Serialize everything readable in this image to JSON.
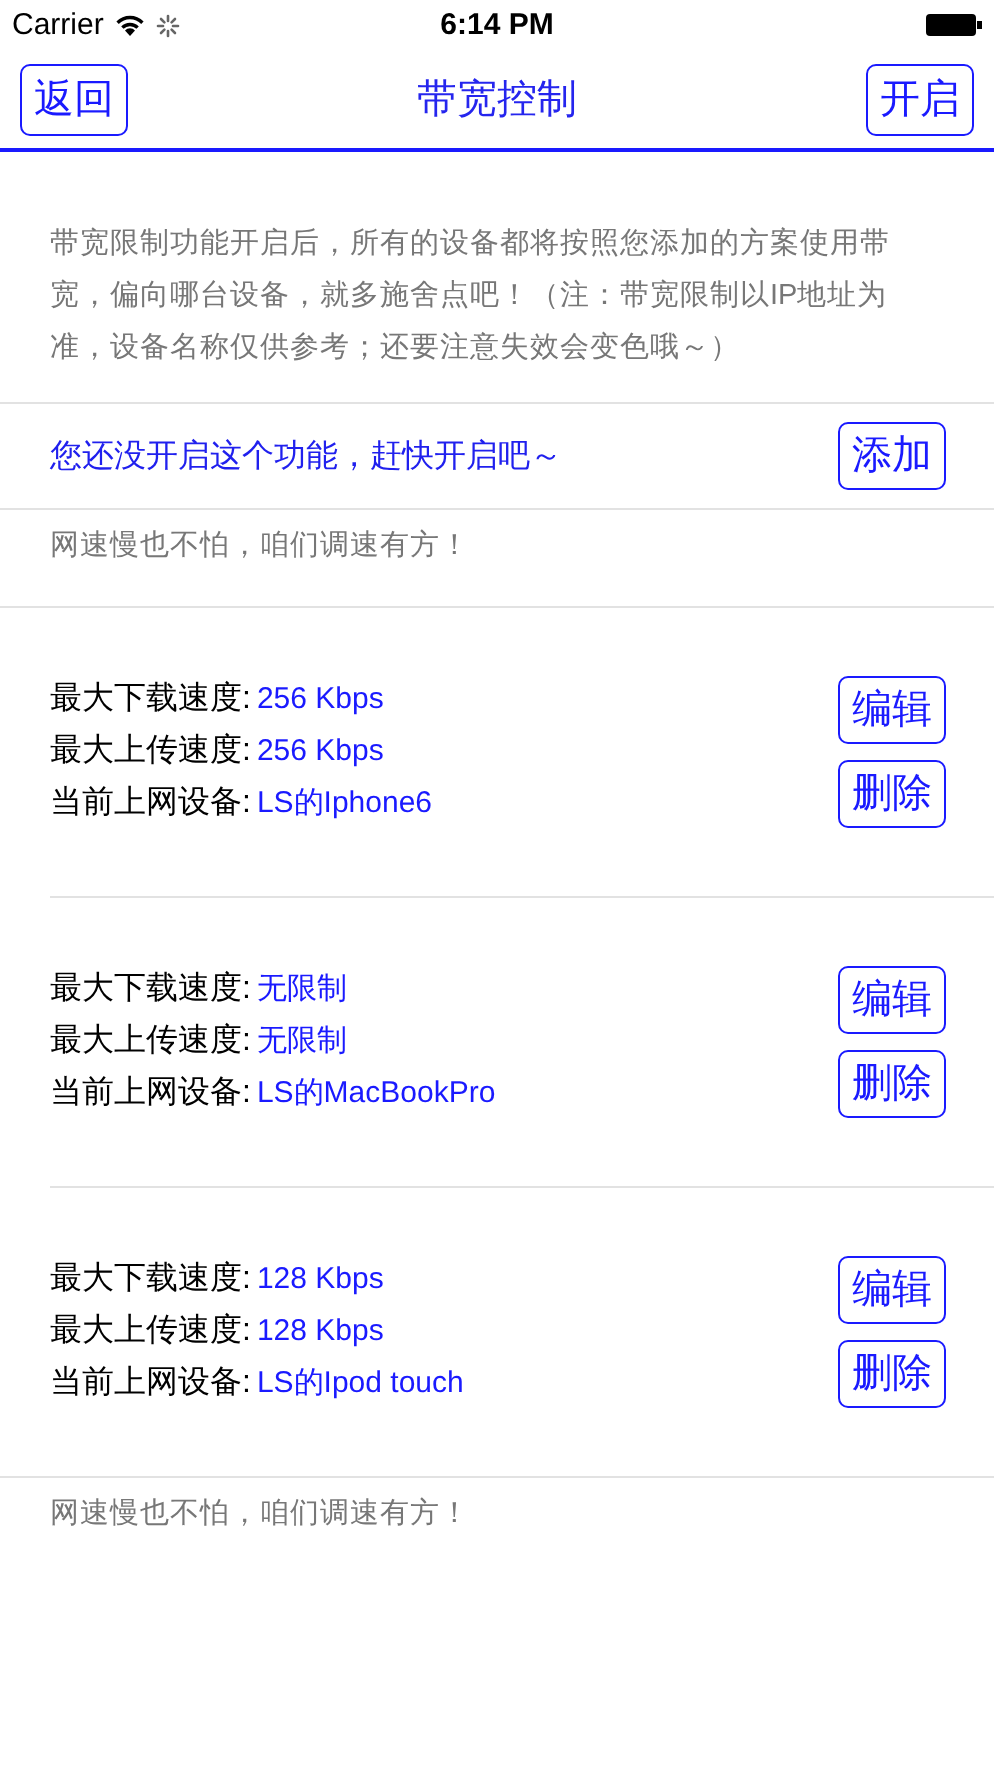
{
  "status_bar": {
    "carrier": "Carrier",
    "time": "6:14 PM"
  },
  "nav": {
    "back": "返回",
    "title": "带宽控制",
    "action": "开启"
  },
  "intro": "带宽限制功能开启后，所有的设备都将按照您添加的方案使用带宽，偏向哪台设备，就多施舍点吧！（注：带宽限制以IP地址为准，设备名称仅供参考；还要注意失效会变色哦～）",
  "notice": {
    "text": "您还没开启这个功能，赶快开启吧～",
    "button": "添加"
  },
  "slogan": "网速慢也不怕，咱们调速有方！",
  "rules": [
    {
      "download_label": "最大下载速度:",
      "download": "256 Kbps",
      "upload_label": "最大上传速度:",
      "upload": "256 Kbps",
      "device_label": "当前上网设备:",
      "device": "LS的Iphone6",
      "edit": "编辑",
      "delete": "删除"
    },
    {
      "download_label": "最大下载速度:",
      "download": "无限制",
      "upload_label": "最大上传速度:",
      "upload": "无限制",
      "device_label": "当前上网设备:",
      "device": "LS的MacBookPro",
      "edit": "编辑",
      "delete": "删除"
    },
    {
      "download_label": "最大下载速度:",
      "download": "128 Kbps",
      "upload_label": "最大上传速度:",
      "upload": "128 Kbps",
      "device_label": "当前上网设备:",
      "device": "LS的Ipod touch",
      "edit": "编辑",
      "delete": "删除"
    }
  ],
  "footer": "网速慢也不怕，咱们调速有方！"
}
